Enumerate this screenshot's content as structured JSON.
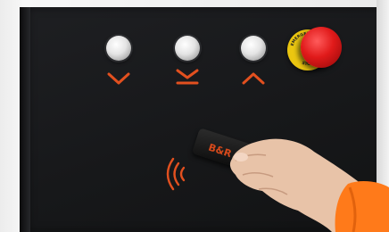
{
  "scene": {
    "description_icons": [
      "chevron-down-icon",
      "down-to-line-icon",
      "chevron-up-icon",
      "nfc-signal-icon"
    ]
  },
  "colors": {
    "panel": "#17181a",
    "arrow_orange": "#e2501f",
    "estop_red": "#e01a1a",
    "estop_yellow": "#f5d219",
    "glove_orange": "#ff7a1a",
    "skin": "#e8c3a8"
  },
  "buttons": [
    {
      "icon": "chevron-down-icon"
    },
    {
      "icon": "down-to-line-icon"
    },
    {
      "icon": "chevron-up-icon"
    }
  ],
  "estop": {
    "label_top": "EMERGENCY",
    "label_bottom": "STOP"
  },
  "keyfob": {
    "label": "B&R"
  }
}
